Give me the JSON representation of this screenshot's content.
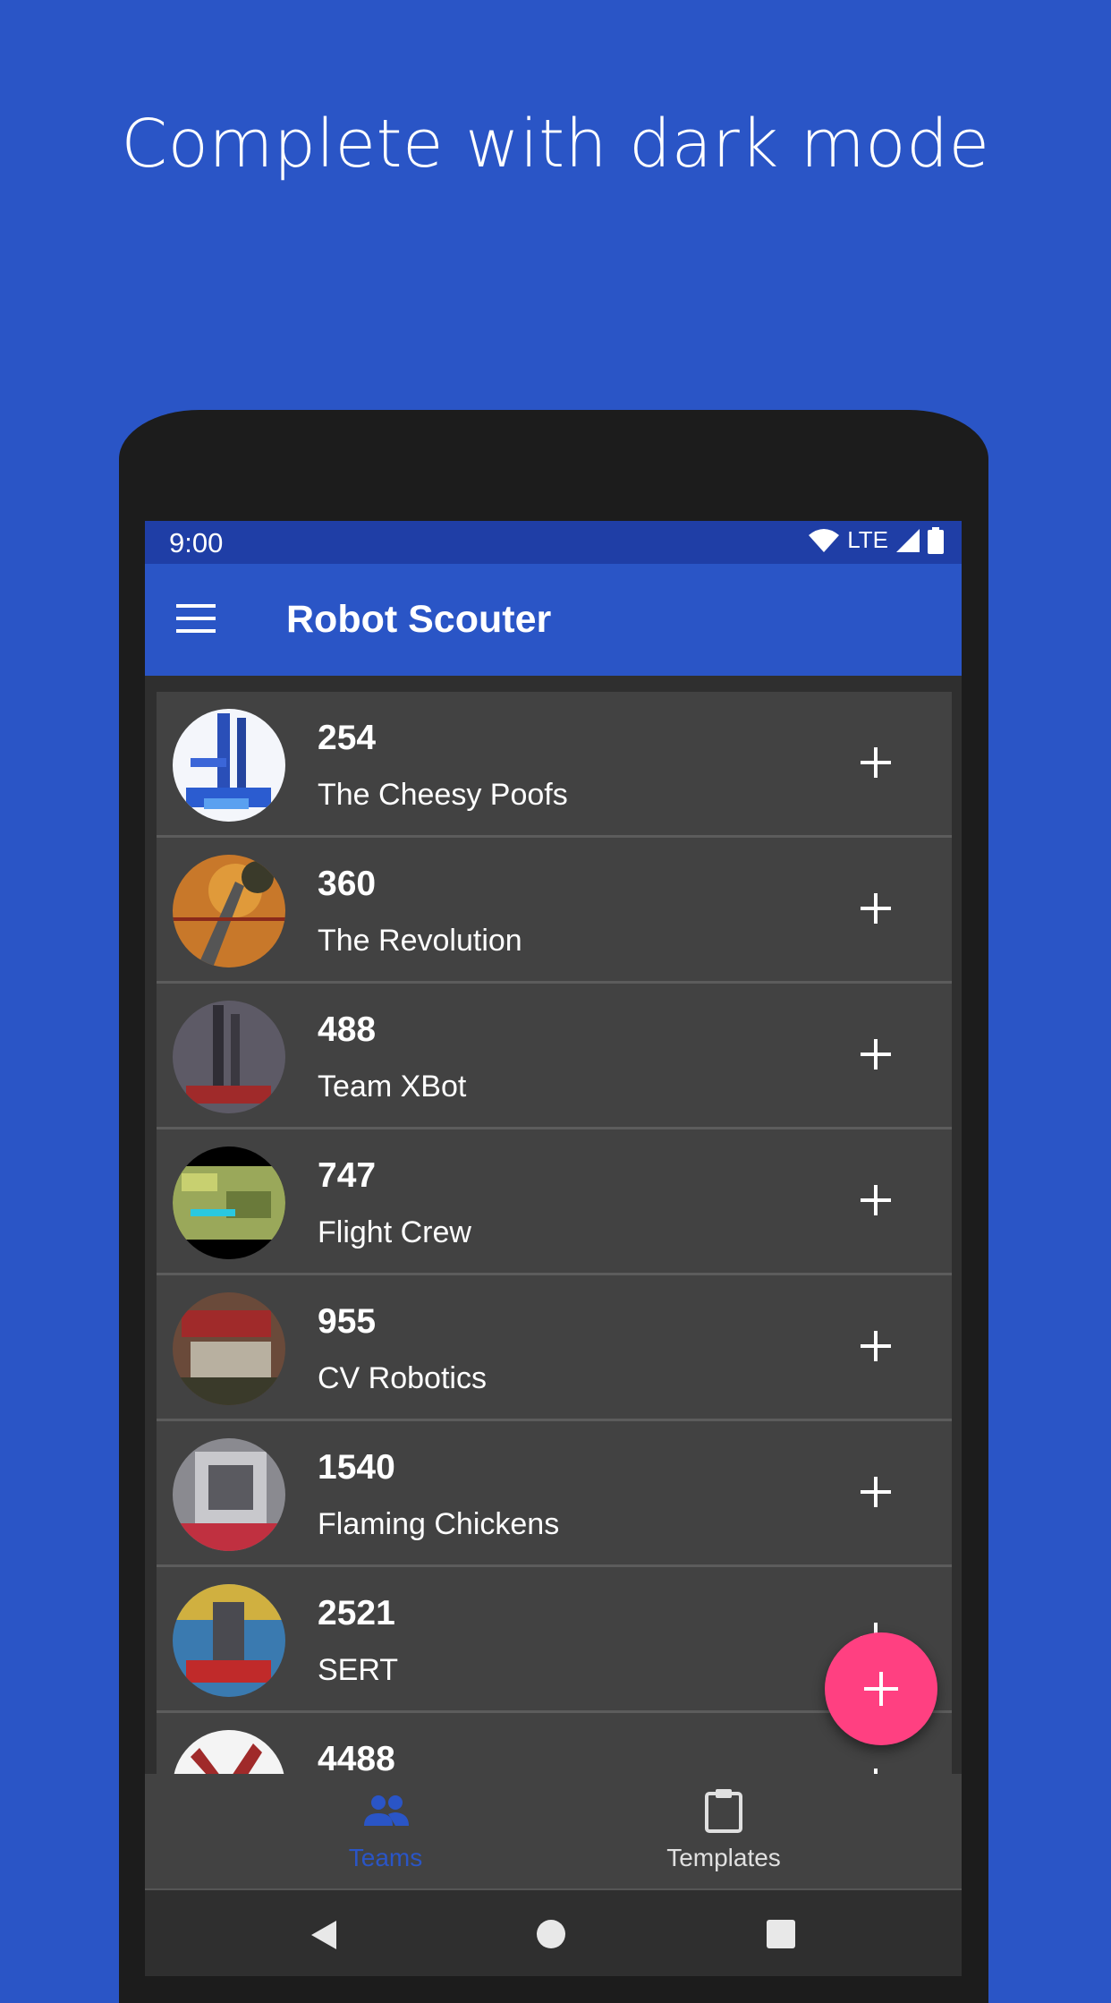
{
  "headline": "Complete with dark mode",
  "status_bar": {
    "time": "9:00",
    "network": "LTE"
  },
  "app_bar": {
    "title": "Robot Scouter"
  },
  "teams": [
    {
      "number": "254",
      "name": "The Cheesy Poofs"
    },
    {
      "number": "360",
      "name": "The Revolution"
    },
    {
      "number": "488",
      "name": "Team XBot"
    },
    {
      "number": "747",
      "name": "Flight Crew"
    },
    {
      "number": "955",
      "name": "CV Robotics"
    },
    {
      "number": "1540",
      "name": "Flaming Chickens"
    },
    {
      "number": "2521",
      "name": "SERT"
    },
    {
      "number": "4488",
      "name": ""
    }
  ],
  "bottom_nav": {
    "teams_label": "Teams",
    "templates_label": "Templates",
    "selected": "Teams"
  },
  "colors": {
    "background": "#2a55c6",
    "status_bar": "#1f3ea6",
    "fab": "#ff4081",
    "row": "#424242"
  },
  "icons": [
    "menu-icon",
    "wifi-icon",
    "signal-icon",
    "battery-icon",
    "add-icon",
    "people-icon",
    "clipboard-icon",
    "back-icon",
    "home-icon",
    "recents-icon"
  ]
}
